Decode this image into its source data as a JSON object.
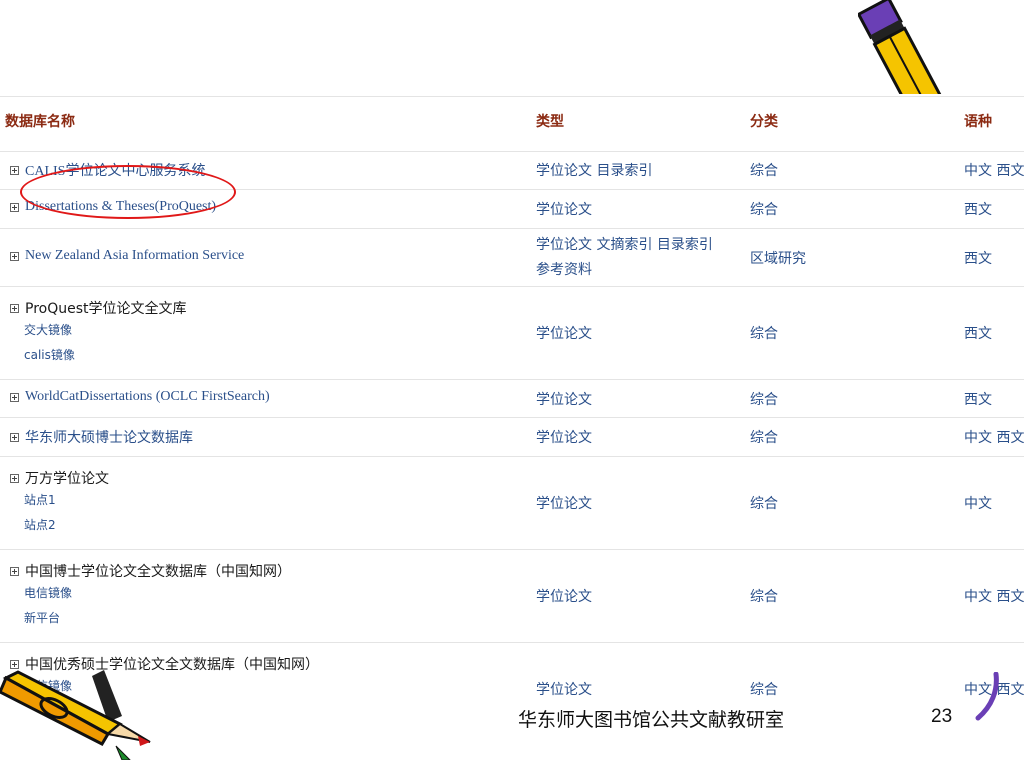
{
  "table": {
    "headers": {
      "name": "数据库名称",
      "type": "类型",
      "category": "分类",
      "language": "语种"
    },
    "rows": [
      {
        "name": "CALIS学位论文中心服务系统",
        "mirrors": [],
        "type": [
          "学位论文 目录索引"
        ],
        "category": "综合",
        "language": "中文 西文"
      },
      {
        "name": "Dissertations & Theses(ProQuest)",
        "mirrors": [],
        "type": [
          "学位论文"
        ],
        "category": "综合",
        "language": "西文"
      },
      {
        "name": "New Zealand Asia Information Service",
        "mirrors": [],
        "type": [
          "学位论文 文摘索引 目录索引",
          "参考资料"
        ],
        "category": "区域研究",
        "language": "西文"
      },
      {
        "name": "ProQuest学位论文全文库",
        "mirrors": [
          "交大镜像",
          "calis镜像"
        ],
        "type": [
          "学位论文"
        ],
        "category": "综合",
        "language": "西文"
      },
      {
        "name": "WorldCatDissertations (OCLC FirstSearch)",
        "mirrors": [],
        "type": [
          "学位论文"
        ],
        "category": "综合",
        "language": "西文"
      },
      {
        "name": "华东师大硕博士论文数据库",
        "mirrors": [],
        "type": [
          "学位论文"
        ],
        "category": "综合",
        "language": "中文 西文"
      },
      {
        "name": "万方学位论文",
        "mirrors": [
          "站点1",
          "站点2"
        ],
        "type": [
          "学位论文"
        ],
        "category": "综合",
        "language": "中文"
      },
      {
        "name": "中国博士学位论文全文数据库（中国知网）",
        "mirrors": [
          "电信镜像",
          "新平台"
        ],
        "type": [
          "学位论文"
        ],
        "category": "综合",
        "language": "中文 西文"
      },
      {
        "name": "中国优秀硕士学位论文全文数据库（中国知网）",
        "mirrors": [
          "电信镜像"
        ],
        "type": [
          "学位论文"
        ],
        "category": "综合",
        "language": "中文 西文"
      }
    ]
  },
  "footer": {
    "text": "华东师大图书馆公共文献教研室",
    "page_number": "23"
  },
  "colors": {
    "header_text": "#8b2a12",
    "link_text": "#2a4f8a",
    "highlight": "#e01818",
    "pencil_body": "#f5c400",
    "pencil_eraser": "#6a3fb5"
  },
  "icons": [
    "pencil-clipart-top",
    "pencil-clipart-bottom",
    "plus-expand-icon"
  ]
}
